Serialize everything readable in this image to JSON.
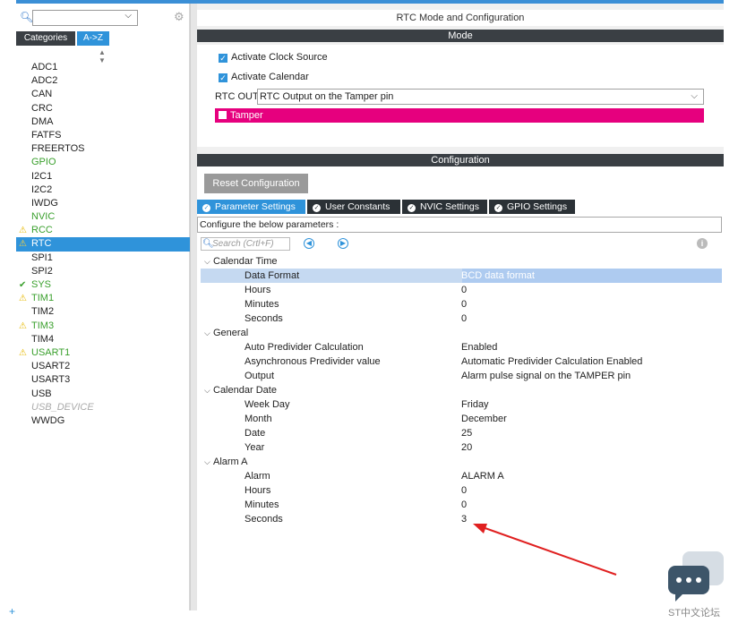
{
  "sidebar": {
    "tabs": {
      "categories": "Categories",
      "az": "A->Z"
    },
    "peripherals": [
      {
        "label": "ADC1",
        "state": "normal"
      },
      {
        "label": "ADC2",
        "state": "normal"
      },
      {
        "label": "CAN",
        "state": "normal"
      },
      {
        "label": "CRC",
        "state": "normal"
      },
      {
        "label": "DMA",
        "state": "normal"
      },
      {
        "label": "FATFS",
        "state": "normal"
      },
      {
        "label": "FREERTOS",
        "state": "normal"
      },
      {
        "label": "GPIO",
        "state": "green"
      },
      {
        "label": "I2C1",
        "state": "normal"
      },
      {
        "label": "I2C2",
        "state": "normal"
      },
      {
        "label": "IWDG",
        "state": "normal"
      },
      {
        "label": "NVIC",
        "state": "green"
      },
      {
        "label": "RCC",
        "state": "warn"
      },
      {
        "label": "RTC",
        "state": "selected-warn"
      },
      {
        "label": "SPI1",
        "state": "normal"
      },
      {
        "label": "SPI2",
        "state": "normal"
      },
      {
        "label": "SYS",
        "state": "ok"
      },
      {
        "label": "TIM1",
        "state": "warn"
      },
      {
        "label": "TIM2",
        "state": "normal"
      },
      {
        "label": "TIM3",
        "state": "warn"
      },
      {
        "label": "TIM4",
        "state": "normal"
      },
      {
        "label": "USART1",
        "state": "warn"
      },
      {
        "label": "USART2",
        "state": "normal"
      },
      {
        "label": "USART3",
        "state": "normal"
      },
      {
        "label": "USB",
        "state": "normal"
      },
      {
        "label": "USB_DEVICE",
        "state": "disabled"
      },
      {
        "label": "WWDG",
        "state": "normal"
      }
    ]
  },
  "main": {
    "title": "RTC Mode and Configuration",
    "mode_header": "Mode",
    "activate_clock_source": "Activate Clock Source",
    "activate_calendar": "Activate Calendar",
    "rtc_out_label": "RTC OUT",
    "rtc_out_value": "RTC Output on the Tamper pin",
    "tamper_label": "Tamper",
    "config_header": "Configuration",
    "reset_button": "Reset Configuration",
    "tabs": [
      "Parameter Settings",
      "User Constants",
      "NVIC Settings",
      "GPIO Settings"
    ],
    "config_note": "Configure the below parameters :",
    "search_placeholder": "Search (Crtl+F)",
    "groups": [
      {
        "name": "Calendar Time",
        "params": [
          {
            "name": "Data Format",
            "value": "BCD data format"
          },
          {
            "name": "Hours",
            "value": "0"
          },
          {
            "name": "Minutes",
            "value": "0"
          },
          {
            "name": "Seconds",
            "value": "0"
          }
        ]
      },
      {
        "name": "General",
        "params": [
          {
            "name": "Auto Predivider Calculation",
            "value": "Enabled"
          },
          {
            "name": "Asynchronous Predivider value",
            "value": "Automatic Predivider Calculation Enabled"
          },
          {
            "name": "Output",
            "value": "Alarm pulse signal on the TAMPER pin"
          }
        ]
      },
      {
        "name": "Calendar Date",
        "params": [
          {
            "name": "Week Day",
            "value": "Friday"
          },
          {
            "name": "Month",
            "value": "December"
          },
          {
            "name": "Date",
            "value": "25"
          },
          {
            "name": "Year",
            "value": "20"
          }
        ]
      },
      {
        "name": "Alarm A",
        "params": [
          {
            "name": "Alarm",
            "value": "ALARM A"
          },
          {
            "name": "Hours",
            "value": "0"
          },
          {
            "name": "Minutes",
            "value": "0"
          },
          {
            "name": "Seconds",
            "value": "3"
          }
        ]
      }
    ]
  },
  "watermark": {
    "text": "ST中文论坛"
  },
  "colors": {
    "accent": "#2f93da",
    "tamper": "#e6007e",
    "header_dark": "#3a3f44",
    "arrow": "#e02020"
  }
}
